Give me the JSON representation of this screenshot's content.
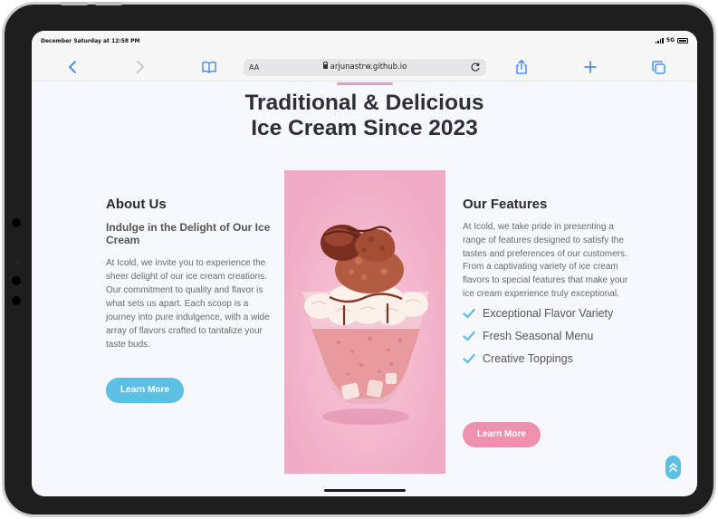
{
  "status": {
    "time": "December Saturday at 12:58 PM",
    "network": "5G"
  },
  "browser": {
    "aa_label": "AA",
    "url": "arjunastrw.github.io"
  },
  "hero": {
    "title_line1": "Traditional & Delicious",
    "title_line2": "Ice Cream Since 2023"
  },
  "about": {
    "heading": "About Us",
    "subheading": "Indulge in the Delight of Our Ice Cream",
    "body": "At Icold, we invite you to experience the sheer delight of our ice cream creations. Our commitment to quality and flavor is what sets us apart. Each scoop is a journey into pure indulgence, with a wide array of flavors crafted to tantalize your taste buds.",
    "button": "Learn More"
  },
  "features": {
    "heading": "Our Features",
    "body": "At Icold, we take pride in presenting a range of features designed to satisfy the tastes and preferences of our customers. From a captivating variety of ice cream flavors to special features that make your ice cream experience truly exceptional.",
    "items": [
      {
        "label": "Exceptional Flavor Variety"
      },
      {
        "label": "Fresh Seasonal Menu"
      },
      {
        "label": "Creative Toppings"
      }
    ],
    "button": "Learn More"
  },
  "colors": {
    "accent_blue": "#5bc0e3",
    "accent_pink": "#ee91b0",
    "title_underline": "#e39bc3",
    "safari_blue": "#2f7df6",
    "page_background": "#f7f8fd"
  },
  "icons": {
    "back": "chevron-left-icon",
    "forward": "chevron-right-icon",
    "bookmarks": "book-icon",
    "lock": "lock-icon",
    "reload": "reload-icon",
    "share": "share-icon",
    "new_tab": "plus-icon",
    "tabs": "tabs-icon",
    "feature_check": "check-icon",
    "scroll_top": "double-chevron-up-icon"
  }
}
